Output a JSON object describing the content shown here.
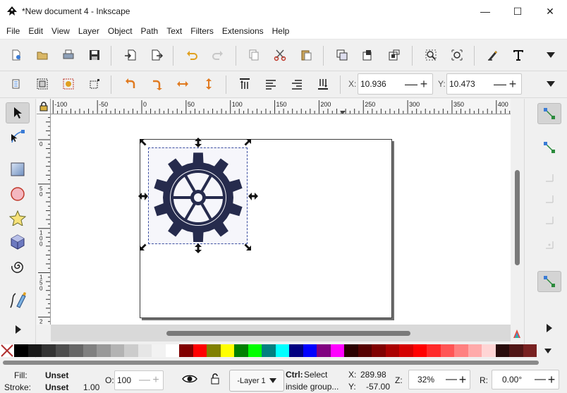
{
  "window": {
    "title": "*New document 4 - Inkscape",
    "min_glyph": "—",
    "max_glyph": "☐",
    "close_glyph": "✕"
  },
  "menu": [
    "File",
    "Edit",
    "View",
    "Layer",
    "Object",
    "Path",
    "Text",
    "Filters",
    "Extensions",
    "Help"
  ],
  "selector_toolbar": {
    "x_label": "X:",
    "x_value": "10.936",
    "y_label": "Y:",
    "y_value": "10.473",
    "minus": "—",
    "plus": "+"
  },
  "rulers": {
    "h_ticks": [
      "-100",
      "-50",
      "0",
      "50",
      "100",
      "150",
      "200",
      "250",
      "300",
      "350",
      "400"
    ],
    "v_ticks": [
      "0",
      "5 0",
      "1 0 0",
      "1 5 0",
      "2 0"
    ]
  },
  "status": {
    "fill_label": "Fill:",
    "fill_value": "Unset",
    "stroke_label": "Stroke:",
    "stroke_value": "Unset",
    "stroke_width": "1.00",
    "opacity_label": "O:",
    "opacity_value": "100",
    "layer": "-Layer 1",
    "hint_key": "Ctrl:",
    "hint_line1": " Select",
    "hint_line2": "inside group...",
    "x_label": "X:",
    "x_value": "289.98",
    "y_label": "Y:",
    "y_value": "-57.00",
    "zoom_label": "Z:",
    "zoom_value": "32%",
    "rotate_label": "R:",
    "rotate_value": "0.00°"
  },
  "palette": [
    "#000000",
    "#1a1a1a",
    "#333333",
    "#4d4d4d",
    "#666666",
    "#808080",
    "#999999",
    "#b3b3b3",
    "#cccccc",
    "#e6e6e6",
    "#f2f2f2",
    "#ffffff",
    "#800000",
    "#ff0000",
    "#808000",
    "#ffff00",
    "#008000",
    "#00ff00",
    "#008080",
    "#00ffff",
    "#000080",
    "#0000ff",
    "#800080",
    "#ff00ff",
    "#2b0000",
    "#550000",
    "#800000",
    "#aa0000",
    "#d40000",
    "#ff0000",
    "#ff2a2a",
    "#ff5555",
    "#ff8080",
    "#ffaaaa",
    "#ffd5d5",
    "#280b0b",
    "#501616",
    "#782121"
  ],
  "colors": {
    "gear": "#262b4d",
    "selection": "#3c4fa0",
    "accent_green": "#1f8a3c"
  }
}
